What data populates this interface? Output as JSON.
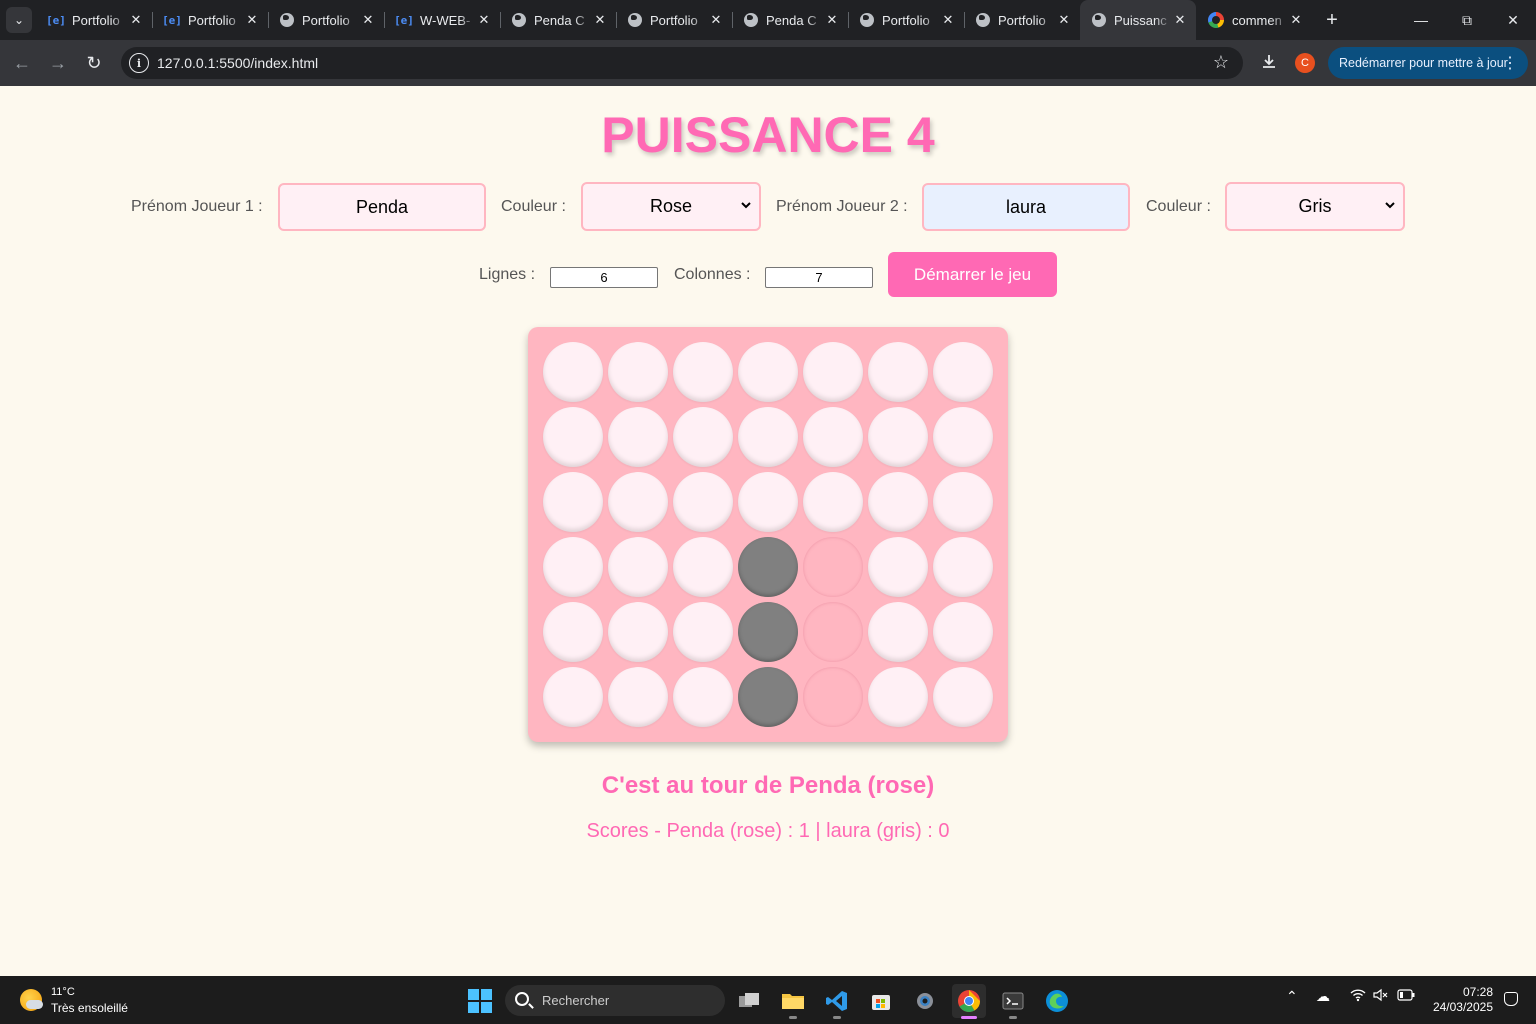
{
  "browser": {
    "tabs": [
      {
        "title": "Portfolio",
        "icon": "e-icon",
        "active": false
      },
      {
        "title": "Portfolio",
        "icon": "e-icon",
        "active": false
      },
      {
        "title": "Portfolio",
        "icon": "globe-icon",
        "active": false
      },
      {
        "title": "W-WEB-",
        "icon": "e-icon",
        "active": false
      },
      {
        "title": "Penda C",
        "icon": "globe-icon",
        "active": false
      },
      {
        "title": "Portfolio",
        "icon": "globe-icon",
        "active": false
      },
      {
        "title": "Penda C",
        "icon": "globe-icon",
        "active": false
      },
      {
        "title": "Portfolio",
        "icon": "globe-icon",
        "active": false
      },
      {
        "title": "Portfolio",
        "icon": "globe-icon",
        "active": false
      },
      {
        "title": "Puissanc",
        "icon": "globe-icon",
        "active": true
      },
      {
        "title": "commen",
        "icon": "google-icon",
        "active": false
      }
    ],
    "url": "127.0.0.1:5500/index.html",
    "profile_initial": "C",
    "update_label": "Redémarrer pour mettre à jour"
  },
  "game": {
    "title": "PUISSANCE 4",
    "player1_label": "Prénom Joueur 1 :",
    "player1_name": "Penda",
    "color1_label": "Couleur :",
    "color1_value": "Rose",
    "player2_label": "Prénom Joueur 2 :",
    "player2_name": "laura",
    "color2_label": "Couleur :",
    "color2_value": "Gris",
    "rows_label": "Lignes :",
    "rows_value": "6",
    "cols_label": "Colonnes :",
    "cols_value": "7",
    "start_label": "Démarrer le jeu",
    "board": [
      [
        "",
        "",
        "",
        "",
        "",
        "",
        ""
      ],
      [
        "",
        "",
        "",
        "",
        "",
        "",
        ""
      ],
      [
        "",
        "",
        "",
        "",
        "",
        "",
        ""
      ],
      [
        "",
        "",
        "",
        "gris",
        "rose",
        "",
        ""
      ],
      [
        "",
        "",
        "",
        "gris",
        "rose",
        "",
        ""
      ],
      [
        "",
        "",
        "",
        "gris",
        "rose",
        "",
        ""
      ]
    ],
    "turn_text": "C'est au tour de Penda (rose)",
    "scores_text": "Scores - Penda (rose) : 1 | laura (gris) : 0"
  },
  "colors": {
    "accent": "#ff69b4",
    "board": "#ffb6c1",
    "empty_cell": "#fff0f5",
    "gris": "#808080",
    "background": "#fdf9ee"
  },
  "taskbar": {
    "temperature": "11°C",
    "weather": "Très ensoleillé",
    "search_placeholder": "Rechercher",
    "time": "07:28",
    "date": "24/03/2025"
  }
}
